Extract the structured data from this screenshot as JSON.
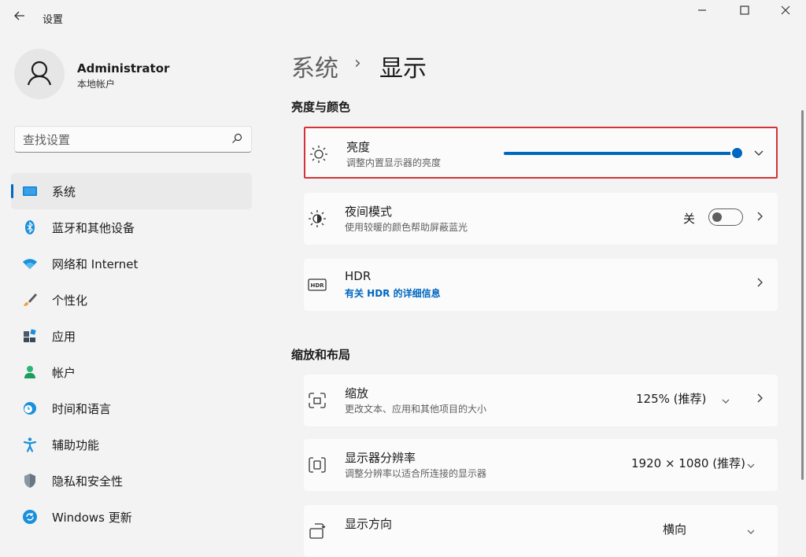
{
  "window": {
    "title": "设置",
    "icons": [
      "back-arrow-icon",
      "minimize-icon",
      "maximize-icon",
      "close-icon"
    ]
  },
  "account": {
    "name": "Administrator",
    "type": "本地帐户"
  },
  "search": {
    "placeholder": "查找设置"
  },
  "sidebar": {
    "items": [
      {
        "label": "系统",
        "icon": "monitor-icon",
        "active": true
      },
      {
        "label": "蓝牙和其他设备",
        "icon": "bluetooth-icon"
      },
      {
        "label": "网络和 Internet",
        "icon": "wifi-icon"
      },
      {
        "label": "个性化",
        "icon": "brush-icon"
      },
      {
        "label": "应用",
        "icon": "apps-icon"
      },
      {
        "label": "帐户",
        "icon": "person-icon"
      },
      {
        "label": "时间和语言",
        "icon": "clock-globe-icon"
      },
      {
        "label": "辅助功能",
        "icon": "accessibility-icon"
      },
      {
        "label": "隐私和安全性",
        "icon": "shield-icon"
      },
      {
        "label": "Windows 更新",
        "icon": "update-icon"
      }
    ]
  },
  "breadcrumb": {
    "parent": "系统",
    "separator": "›",
    "current": "显示"
  },
  "sections": {
    "brightness_color": "亮度与颜色",
    "scale_layout": "缩放和布局"
  },
  "cards": {
    "brightness": {
      "title": "亮度",
      "subtitle": "调整内置显示器的亮度",
      "level_percent": 100
    },
    "night_light": {
      "title": "夜间模式",
      "subtitle": "使用较暖的颜色帮助屏蔽蓝光",
      "state": "关"
    },
    "hdr": {
      "title": "HDR",
      "link": "有关 HDR 的详细信息"
    },
    "scale": {
      "title": "缩放",
      "subtitle": "更改文本、应用和其他项目的大小",
      "value": "125% (推荐)"
    },
    "resolution": {
      "title": "显示器分辨率",
      "subtitle": "调整分辨率以适合所连接的显示器",
      "value": "1920 × 1080 (推荐)"
    },
    "orientation": {
      "title": "显示方向",
      "value": "横向"
    }
  },
  "colors": {
    "accent": "#0067c0",
    "highlight_border": "#d13438",
    "background": "#f3f3f3",
    "card": "#fbfbfb"
  }
}
